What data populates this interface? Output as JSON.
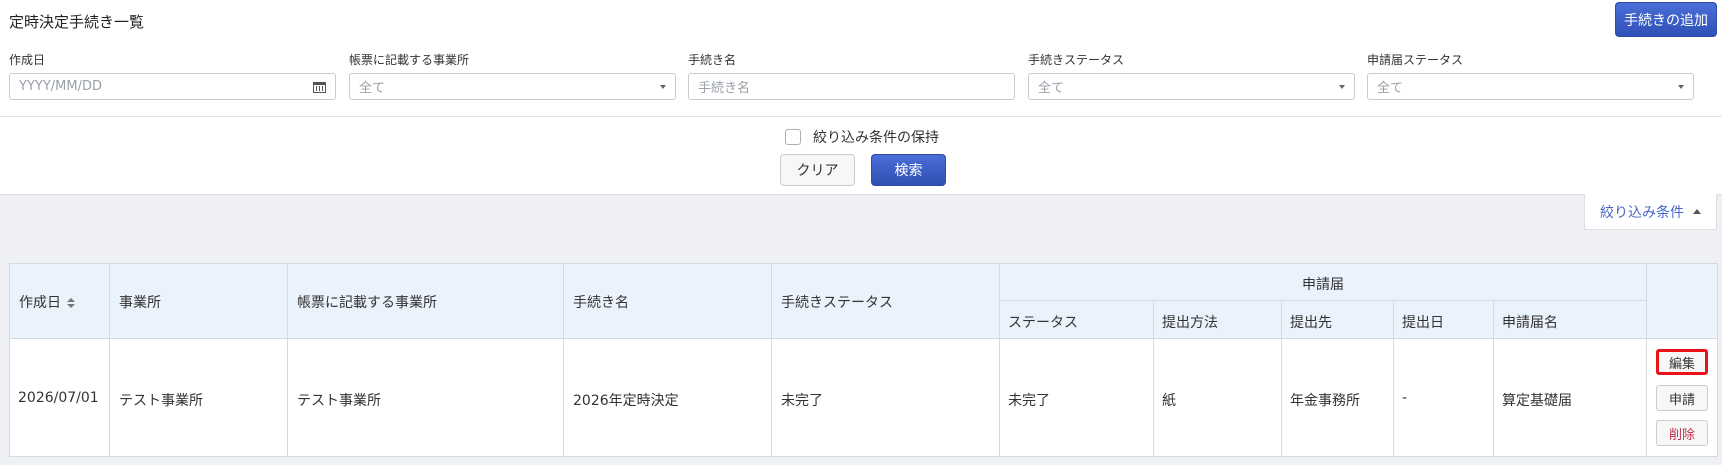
{
  "page": {
    "title": "定時決定手続き一覧",
    "add_button": "手続きの追加"
  },
  "filters": {
    "created_date": {
      "label": "作成日",
      "placeholder": "YYYY/MM/DD"
    },
    "office_on_form": {
      "label": "帳票に記載する事業所",
      "value": "全て"
    },
    "procedure_name": {
      "label": "手続き名",
      "placeholder": "手続き名"
    },
    "procedure_status": {
      "label": "手続きステータス",
      "value": "全て"
    },
    "application_status": {
      "label": "申請届ステータス",
      "value": "全て"
    },
    "keep_conditions": "絞り込み条件の保持",
    "clear_button": "クリア",
    "search_button": "検索",
    "toggle_label": "絞り込み条件"
  },
  "table": {
    "headers": {
      "created_date": "作成日",
      "office": "事業所",
      "office_on_form": "帳票に記載する事業所",
      "procedure_name": "手続き名",
      "procedure_status": "手続きステータス",
      "application_group": "申請届",
      "status": "ステータス",
      "submit_method": "提出方法",
      "submit_to": "提出先",
      "submit_date": "提出日",
      "application_name": "申請届名"
    },
    "rows": [
      {
        "created_date": "2026/07/01",
        "office": "テスト事業所",
        "office_on_form": "テスト事業所",
        "procedure_name": "2026年定時決定",
        "procedure_status": "未完了",
        "status": "未完了",
        "submit_method": "紙",
        "submit_to": "年金事務所",
        "submit_date": "-",
        "application_name": "算定基礎届",
        "actions": {
          "edit": "編集",
          "apply": "申請",
          "delete": "削除"
        }
      }
    ]
  },
  "colors": {
    "primary": "#3a5cc6",
    "header_bg": "#eaf2fc",
    "delete": "#c0304c",
    "highlight": "#e8141a"
  }
}
